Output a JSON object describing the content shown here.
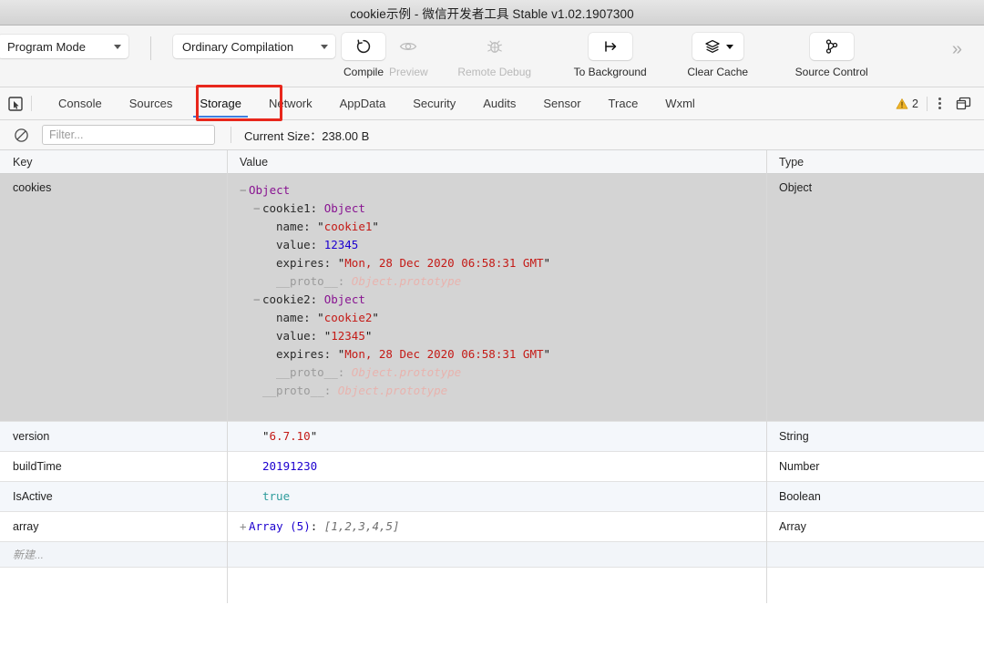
{
  "window": {
    "title": "cookie示例 - 微信开发者工具 Stable v1.02.1907300"
  },
  "toolbar": {
    "mode_select": {
      "label": "Program Mode",
      "icon": "chevron-down-icon"
    },
    "compile_select": {
      "label": "Ordinary Compilation",
      "icon": "chevron-down-icon"
    },
    "buttons": [
      {
        "id": "compile",
        "label": "Compile",
        "icon": "refresh-icon",
        "disabled": false
      },
      {
        "id": "preview",
        "label": "Preview",
        "icon": "eye-icon",
        "disabled": true
      },
      {
        "id": "remote-debug",
        "label": "Remote Debug",
        "icon": "bug-icon",
        "disabled": true
      },
      {
        "id": "to-background",
        "label": "To Background",
        "icon": "to-background-icon",
        "disabled": false
      },
      {
        "id": "clear-cache",
        "label": "Clear Cache",
        "icon": "layers-icon",
        "disabled": false
      },
      {
        "id": "source-control",
        "label": "Source Control",
        "icon": "branch-icon",
        "disabled": false
      }
    ],
    "overflow_label": "»"
  },
  "devtools": {
    "inspect_icon": "inspect-element-icon",
    "tabs": [
      {
        "id": "console",
        "label": "Console",
        "active": false
      },
      {
        "id": "sources",
        "label": "Sources",
        "active": false
      },
      {
        "id": "storage",
        "label": "Storage",
        "active": true
      },
      {
        "id": "network",
        "label": "Network",
        "active": false
      },
      {
        "id": "appdata",
        "label": "AppData",
        "active": false
      },
      {
        "id": "security",
        "label": "Security",
        "active": false
      },
      {
        "id": "audits",
        "label": "Audits",
        "active": false
      },
      {
        "id": "sensor",
        "label": "Sensor",
        "active": false
      },
      {
        "id": "trace",
        "label": "Trace",
        "active": false
      },
      {
        "id": "wxml",
        "label": "Wxml",
        "active": false
      }
    ],
    "warning_count": "2",
    "warning_icon": "warning-triangle-icon",
    "kebab_icon": "more-vertical-icon",
    "dock_icon": "dock-panel-icon",
    "highlight_color": "#e8271c"
  },
  "filterbar": {
    "clear_icon": "clear-circle-slash-icon",
    "filter_placeholder": "Filter...",
    "filter_value": "",
    "size_label": "Current Size：238.00 B"
  },
  "table": {
    "headers": {
      "key": "Key",
      "value": "Value",
      "type": "Type"
    },
    "rows": [
      {
        "key": "cookies",
        "type": "Object",
        "selected": true,
        "tree": [
          {
            "indent": 0,
            "toggle": "−",
            "segments": [
              {
                "text": "Object",
                "cls": "k-obj"
              }
            ]
          },
          {
            "indent": 1,
            "toggle": "−",
            "segments": [
              {
                "text": "cookie1: ",
                "cls": "k-prop"
              },
              {
                "text": "Object",
                "cls": "k-obj"
              }
            ]
          },
          {
            "indent": 2,
            "toggle": "",
            "segments": [
              {
                "text": "name: ",
                "cls": "k-prop"
              },
              {
                "text": "\"",
                "cls": "quote"
              },
              {
                "text": "cookie1",
                "cls": "k-str"
              },
              {
                "text": "\"",
                "cls": "quote"
              }
            ]
          },
          {
            "indent": 2,
            "toggle": "",
            "segments": [
              {
                "text": "value: ",
                "cls": "k-prop"
              },
              {
                "text": "12345",
                "cls": "k-num"
              }
            ]
          },
          {
            "indent": 2,
            "toggle": "",
            "segments": [
              {
                "text": "expires: ",
                "cls": "k-prop"
              },
              {
                "text": "\"",
                "cls": "quote"
              },
              {
                "text": "Mon, 28 Dec 2020 06:58:31 GMT",
                "cls": "k-str"
              },
              {
                "text": "\"",
                "cls": "quote"
              }
            ]
          },
          {
            "indent": 2,
            "toggle": "",
            "segments": [
              {
                "text": "__proto__: ",
                "cls": "k-proto"
              },
              {
                "text": "Object.prototype",
                "cls": "k-proto-val"
              }
            ]
          },
          {
            "indent": 1,
            "toggle": "−",
            "segments": [
              {
                "text": "cookie2: ",
                "cls": "k-prop"
              },
              {
                "text": "Object",
                "cls": "k-obj"
              }
            ]
          },
          {
            "indent": 2,
            "toggle": "",
            "segments": [
              {
                "text": "name: ",
                "cls": "k-prop"
              },
              {
                "text": "\"",
                "cls": "quote"
              },
              {
                "text": "cookie2",
                "cls": "k-str"
              },
              {
                "text": "\"",
                "cls": "quote"
              }
            ]
          },
          {
            "indent": 2,
            "toggle": "",
            "segments": [
              {
                "text": "value: ",
                "cls": "k-prop"
              },
              {
                "text": "\"",
                "cls": "quote"
              },
              {
                "text": "12345",
                "cls": "k-str"
              },
              {
                "text": "\"",
                "cls": "quote"
              }
            ]
          },
          {
            "indent": 2,
            "toggle": "",
            "segments": [
              {
                "text": "expires: ",
                "cls": "k-prop"
              },
              {
                "text": "\"",
                "cls": "quote"
              },
              {
                "text": "Mon, 28 Dec 2020 06:58:31 GMT",
                "cls": "k-str"
              },
              {
                "text": "\"",
                "cls": "quote"
              }
            ]
          },
          {
            "indent": 2,
            "toggle": "",
            "segments": [
              {
                "text": "__proto__: ",
                "cls": "k-proto"
              },
              {
                "text": "Object.prototype",
                "cls": "k-proto-val"
              }
            ]
          },
          {
            "indent": 1,
            "toggle": "",
            "segments": [
              {
                "text": "__proto__: ",
                "cls": "k-proto"
              },
              {
                "text": "Object.prototype",
                "cls": "k-proto-val"
              }
            ]
          }
        ]
      },
      {
        "key": "version",
        "type": "String",
        "zebra": true,
        "tree": [
          {
            "indent": 1,
            "toggle": "",
            "segments": [
              {
                "text": "\"",
                "cls": "quote"
              },
              {
                "text": "6.7.10",
                "cls": "k-str"
              },
              {
                "text": "\"",
                "cls": "quote"
              }
            ]
          }
        ]
      },
      {
        "key": "buildTime",
        "type": "Number",
        "zebra": false,
        "tree": [
          {
            "indent": 1,
            "toggle": "",
            "segments": [
              {
                "text": "20191230",
                "cls": "k-num"
              }
            ]
          }
        ]
      },
      {
        "key": "IsActive",
        "type": "Boolean",
        "zebra": true,
        "tree": [
          {
            "indent": 1,
            "toggle": "",
            "segments": [
              {
                "text": "true",
                "cls": "k-bool"
              }
            ]
          }
        ]
      },
      {
        "key": "array",
        "type": "Array",
        "zebra": false,
        "tree": [
          {
            "indent": 0,
            "toggle": "+",
            "segments": [
              {
                "text": "Array (5)",
                "cls": "k-arr"
              },
              {
                "text": ": ",
                "cls": "k-prop"
              },
              {
                "text": "[1,2,3,4,5]",
                "cls": "k-arrprev"
              }
            ]
          }
        ]
      }
    ],
    "new_row_label": "新建..."
  }
}
